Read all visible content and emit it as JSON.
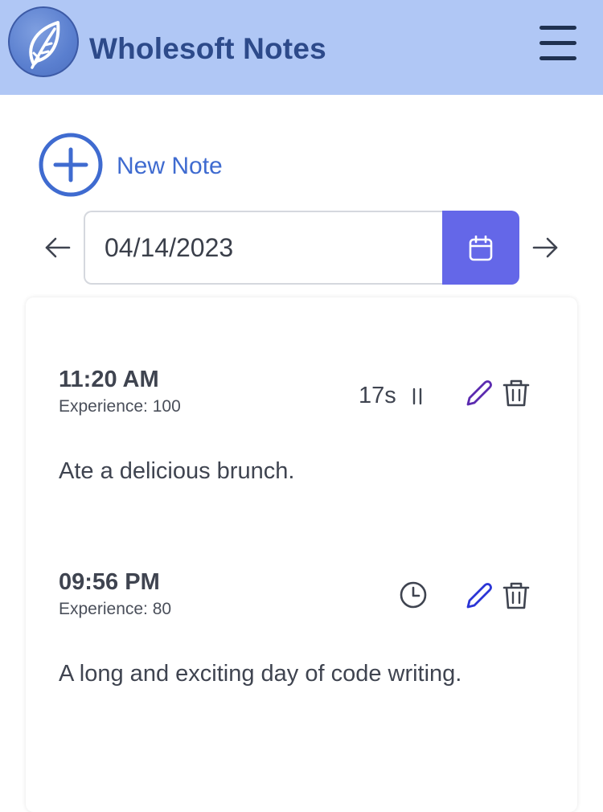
{
  "header": {
    "app_title": "Wholesoft Notes"
  },
  "toolbar": {
    "new_note_label": "New Note"
  },
  "date_picker": {
    "value": "04/14/2023"
  },
  "colors": {
    "header_bg": "#b0c7f5",
    "accent_blue": "#3f6bd0",
    "calendar_button": "#6467e8",
    "edit_icon_first": "#5b2bb0",
    "edit_icon_second": "#2b35d6"
  },
  "notes": [
    {
      "time": "11:20 AM",
      "experience": "Experience: 100",
      "body": "Ate a delicious brunch.",
      "timer": "17s",
      "timer_icon": "pause-icon"
    },
    {
      "time": "09:56 PM",
      "experience": "Experience: 80",
      "body": "A long and exciting day of code writing.",
      "timer": "",
      "timer_icon": "clock-icon"
    }
  ]
}
